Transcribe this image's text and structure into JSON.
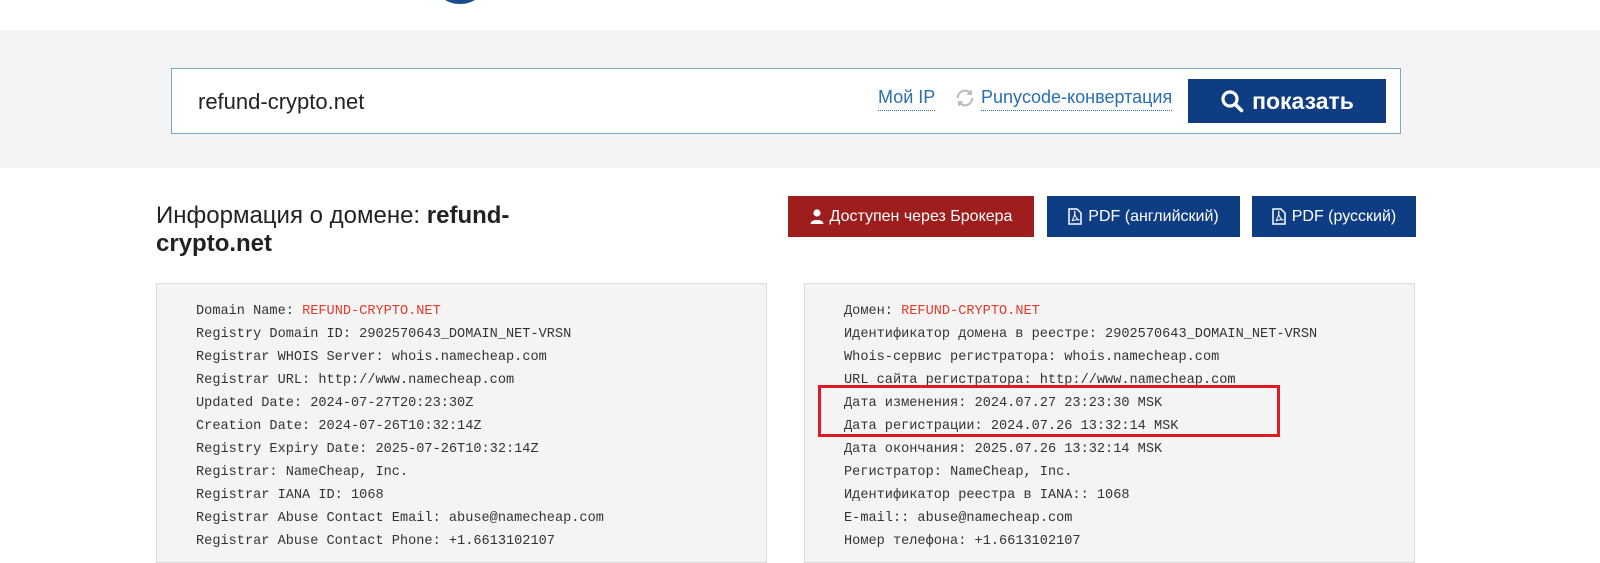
{
  "search": {
    "value": "refund-crypto.net",
    "my_ip": "Мой IP",
    "punycode": "Punycode-конвертация",
    "show_label": "показать"
  },
  "heading": {
    "prefix": "Информация о домене: ",
    "domain": "refund-crypto.net"
  },
  "actions": {
    "broker": "Доступен через Брокера",
    "pdf_en": "PDF (английский)",
    "pdf_ru": "PDF (русский)"
  },
  "colors": {
    "primary": "#0f3d84",
    "broker": "#9e1d1d",
    "highlight": "#e01a22",
    "domain_red": "#e33b2a"
  },
  "whois_en": [
    {
      "label": "Domain Name: ",
      "value": "REFUND-CRYPTO.NET",
      "hl": true
    },
    {
      "label": "Registry Domain ID: ",
      "value": "2902570643_DOMAIN_NET-VRSN"
    },
    {
      "label": "Registrar WHOIS Server: ",
      "value": "whois.namecheap.com"
    },
    {
      "label": "Registrar URL: ",
      "value": "http://www.namecheap.com"
    },
    {
      "label": "Updated Date: ",
      "value": "2024-07-27T20:23:30Z"
    },
    {
      "label": "Creation Date: ",
      "value": "2024-07-26T10:32:14Z"
    },
    {
      "label": "Registry Expiry Date: ",
      "value": "2025-07-26T10:32:14Z"
    },
    {
      "label": "Registrar: ",
      "value": "NameCheap, Inc."
    },
    {
      "label": "Registrar IANA ID: ",
      "value": "1068"
    },
    {
      "label": "Registrar Abuse Contact Email: ",
      "value": "abuse@namecheap.com"
    },
    {
      "label": "Registrar Abuse Contact Phone: ",
      "value": "+1.6613102107"
    }
  ],
  "whois_ru": [
    {
      "label": "Домен: ",
      "value": "REFUND-CRYPTO.NET",
      "hl": true
    },
    {
      "label": "Идентификатор домена в реестре: ",
      "value": "2902570643_DOMAIN_NET-VRSN"
    },
    {
      "label": "Whois-сервис регистратора: ",
      "value": "whois.namecheap.com"
    },
    {
      "label": "URL сайта регистратора: ",
      "value": "http://www.namecheap.com"
    },
    {
      "label": "Дата изменения: ",
      "value": "2024.07.27 23:23:30 MSK"
    },
    {
      "label": "Дата регистрации: ",
      "value": "2024.07.26 13:32:14 MSK"
    },
    {
      "label": "Дата окончания: ",
      "value": "2025.07.26 13:32:14 MSK"
    },
    {
      "label": "Регистратор: ",
      "value": "NameCheap, Inc."
    },
    {
      "label": "Идентификатор реестра в IANA:: ",
      "value": "1068"
    },
    {
      "label": "E-mail:: ",
      "value": "abuse@namecheap.com"
    },
    {
      "label": "Номер телефона: ",
      "value": "+1.6613102107"
    }
  ]
}
